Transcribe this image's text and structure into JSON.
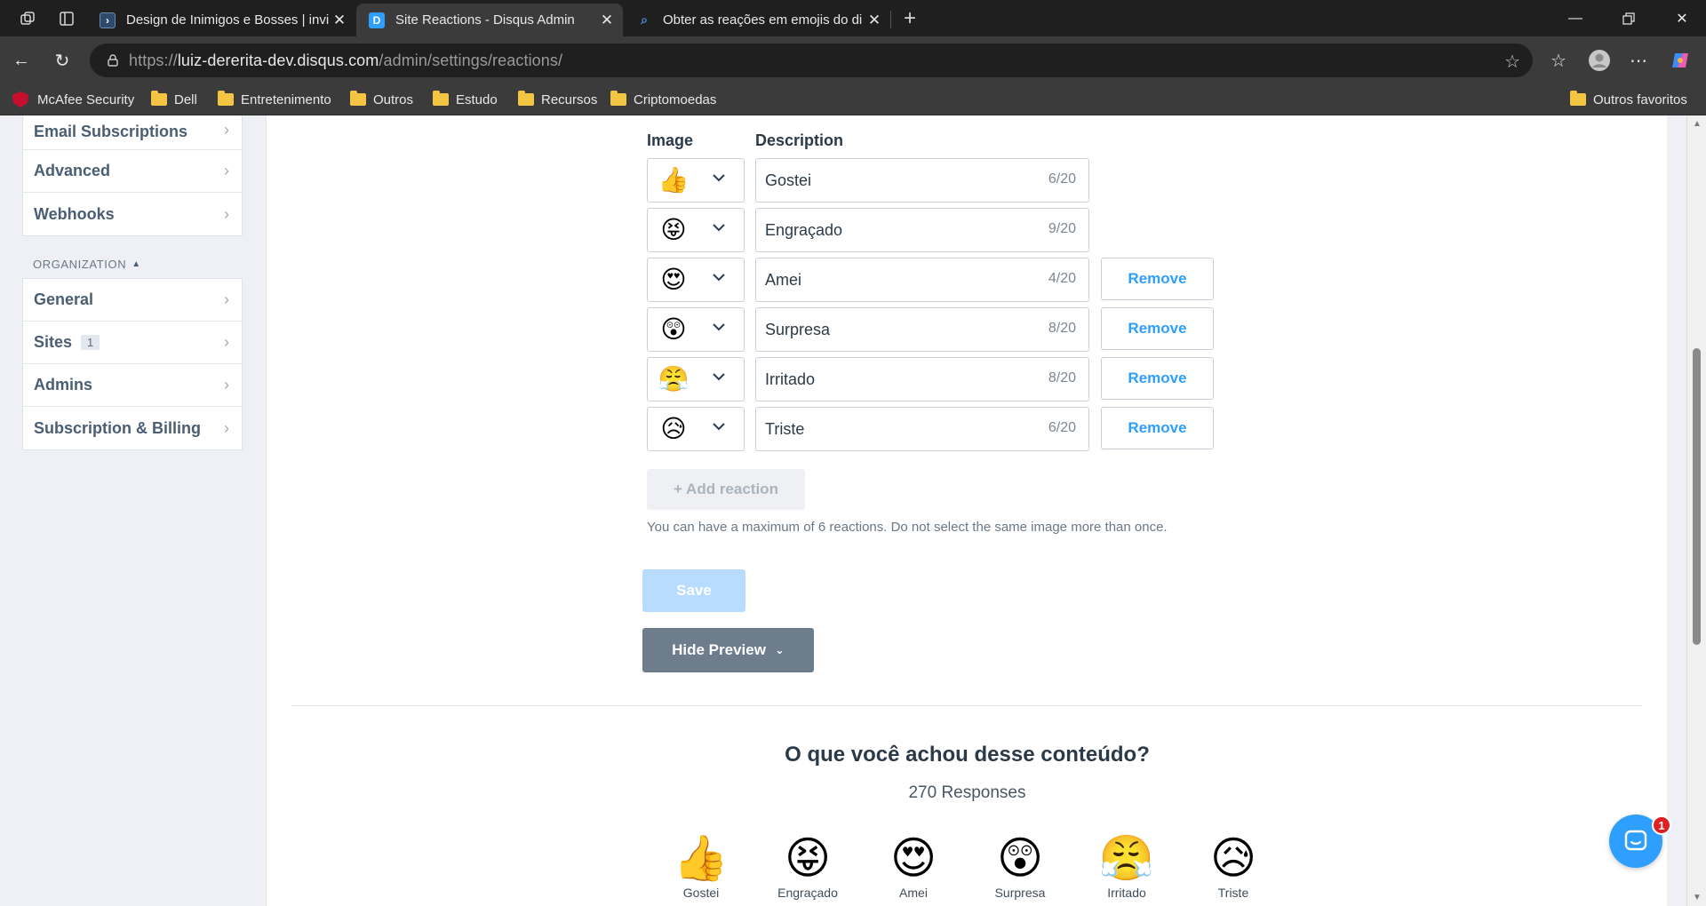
{
  "browser": {
    "tabs": [
      {
        "title": "Design de Inimigos e Bosses | invi",
        "active": false
      },
      {
        "title": "Site Reactions - Disqus Admin",
        "active": true
      },
      {
        "title": "Obter as reações em emojis do di",
        "active": false
      }
    ],
    "url": {
      "scheme": "https://",
      "host": "luiz-dererita-dev.disqus.com",
      "path": "/admin/settings/reactions/"
    },
    "bookmarks": [
      "McAfee Security",
      "Dell",
      "Entretenimento",
      "Outros",
      "Estudo",
      "Recursos",
      "Criptomoedas"
    ],
    "other_favorites": "Outros favoritos"
  },
  "sidebar": {
    "top_items": [
      {
        "label": "Email Subscriptions"
      },
      {
        "label": "Advanced"
      },
      {
        "label": "Webhooks"
      }
    ],
    "org_heading": "ORGANIZATION",
    "org_items": [
      {
        "label": "General",
        "badge": ""
      },
      {
        "label": "Sites",
        "badge": "1"
      },
      {
        "label": "Admins",
        "badge": ""
      },
      {
        "label": "Subscription & Billing",
        "badge": ""
      }
    ]
  },
  "reactions_form": {
    "image_header": "Image",
    "description_header": "Description",
    "rows": [
      {
        "emoji": "👍",
        "description": "Gostei",
        "count": "6/20",
        "removable": false
      },
      {
        "emoji": "😝",
        "description": "Engraçado",
        "count": "9/20",
        "removable": false
      },
      {
        "emoji": "😍",
        "description": "Amei",
        "count": "4/20",
        "removable": true
      },
      {
        "emoji": "😲",
        "description": "Surpresa",
        "count": "8/20",
        "removable": true
      },
      {
        "emoji": "😤",
        "description": "Irritado",
        "count": "8/20",
        "removable": true
      },
      {
        "emoji": "😥",
        "description": "Triste",
        "count": "6/20",
        "removable": true
      }
    ],
    "remove_label": "Remove",
    "add_label": "+ Add reaction",
    "note": "You can have a maximum of 6 reactions. Do not select the same image more than once.",
    "save_label": "Save",
    "preview_toggle_label": "Hide Preview"
  },
  "preview": {
    "title": "O que você achou desse conteúdo?",
    "responses": "270 Responses",
    "reactions": [
      {
        "emoji": "👍",
        "label": "Gostei"
      },
      {
        "emoji": "😝",
        "label": "Engraçado"
      },
      {
        "emoji": "😍",
        "label": "Amei"
      },
      {
        "emoji": "😲",
        "label": "Surpresa"
      },
      {
        "emoji": "😤",
        "label": "Irritado"
      },
      {
        "emoji": "😥",
        "label": "Triste"
      }
    ]
  },
  "chat": {
    "badge": "1"
  },
  "colors": {
    "accent": "#2e9fff",
    "save_disabled": "#b7dcff",
    "preview_button": "#6d7d8c",
    "sidebar_text": "#4a5e73"
  }
}
